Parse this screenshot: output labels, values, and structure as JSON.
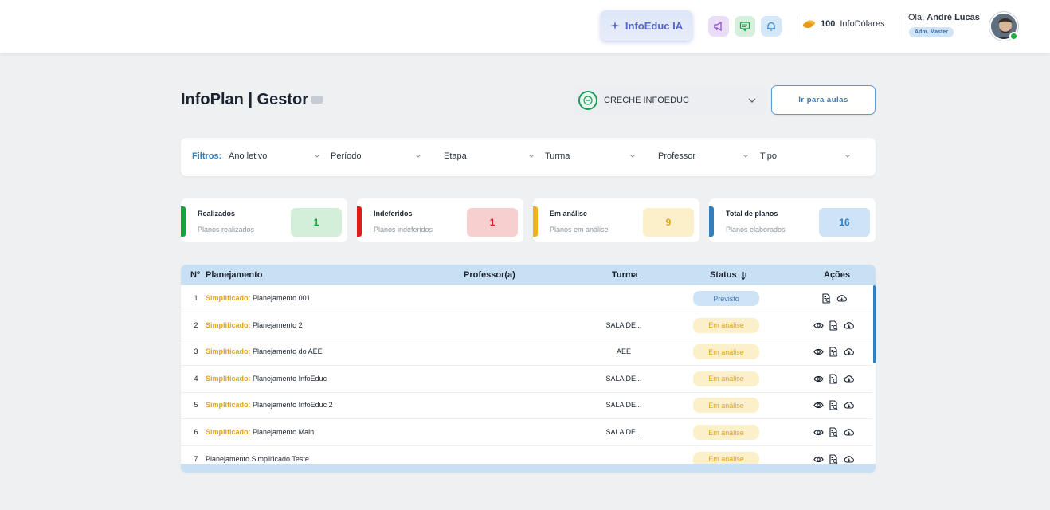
{
  "header": {
    "ia_button": "InfoEduc IA",
    "coins_amount": "100",
    "coins_label": "InfoDólares",
    "greeting_prefix": "Olá,",
    "user_name": "André Lucas",
    "role": "Adm. Master",
    "icons": [
      "megaphone-icon",
      "chat-icon",
      "bell-icon",
      "coins-icon"
    ]
  },
  "page": {
    "title": "InfoPlan | Gestor",
    "school": "CRECHE INFOEDUC",
    "go_button": "Ir para aulas"
  },
  "filters": {
    "label": "Filtros:",
    "items": [
      "Ano letivo",
      "Período",
      "Etapa",
      "Turma",
      "Professor",
      "Tipo"
    ]
  },
  "stats": [
    {
      "title": "Realizados",
      "subtitle": "Planos realizados",
      "value": "1",
      "bar_color": "#17a33a",
      "bg": "#d3efd9",
      "fg": "#17a33a"
    },
    {
      "title": "Indeferidos",
      "subtitle": "Planos indeferidos",
      "value": "1",
      "bar_color": "#e01b1b",
      "bg": "#f8cfcf",
      "fg": "#d91c1c"
    },
    {
      "title": "Em análise",
      "subtitle": "Planos em análise",
      "value": "9",
      "bar_color": "#efb21b",
      "bg": "#fbf0c9",
      "fg": "#e0a51b"
    },
    {
      "title": "Total de planos",
      "subtitle": "Planos elaborados",
      "value": "16",
      "bar_color": "#2f7fc1",
      "bg": "#cfe3f6",
      "fg": "#2f7fc1"
    }
  ],
  "table": {
    "headers": {
      "num": "Nº",
      "plan": "Planejamento",
      "prof": "Professor(a)",
      "turma": "Turma",
      "status": "Status",
      "acoes": "Ações"
    },
    "rows": [
      {
        "num": "1",
        "tag": "Simplificado:",
        "name": "Planejamento 001",
        "turma": "",
        "status": "Previsto",
        "status_type": "previsto",
        "actions": [
          "review-doc-icon",
          "download-cloud-icon"
        ]
      },
      {
        "num": "2",
        "tag": "Simplificado:",
        "name": "Planejamento 2",
        "turma": "SALA DE...",
        "status": "Em análise",
        "status_type": "analise",
        "actions": [
          "eye-icon",
          "review-doc-icon",
          "download-cloud-icon"
        ]
      },
      {
        "num": "3",
        "tag": "Simplificado:",
        "name": "Planejamento do AEE",
        "turma": "AEE",
        "status": "Em análise",
        "status_type": "analise",
        "actions": [
          "eye-icon",
          "review-doc-icon",
          "download-cloud-icon"
        ]
      },
      {
        "num": "4",
        "tag": "Simplificado:",
        "name": "Planejamento InfoEduc",
        "turma": "SALA DE...",
        "status": "Em análise",
        "status_type": "analise",
        "actions": [
          "eye-icon",
          "review-doc-icon",
          "download-cloud-icon"
        ]
      },
      {
        "num": "5",
        "tag": "Simplificado:",
        "name": "Planejamento InfoEduc 2",
        "turma": "SALA DE...",
        "status": "Em análise",
        "status_type": "analise",
        "actions": [
          "eye-icon",
          "review-doc-icon",
          "download-cloud-icon"
        ]
      },
      {
        "num": "6",
        "tag": "Simplificado:",
        "name": "Planejamento Main",
        "turma": "SALA DE...",
        "status": "Em análise",
        "status_type": "analise",
        "actions": [
          "eye-icon",
          "review-doc-icon",
          "download-cloud-icon"
        ]
      },
      {
        "num": "7",
        "tag": "",
        "name": "Planejamento Simplificado Teste",
        "turma": "",
        "status": "Em análise",
        "status_type": "analise",
        "actions": [
          "eye-icon",
          "review-doc-icon",
          "download-cloud-icon"
        ]
      }
    ]
  }
}
